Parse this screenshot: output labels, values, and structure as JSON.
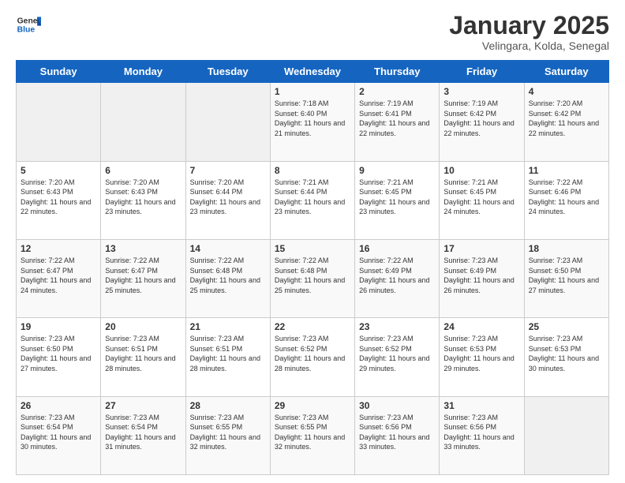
{
  "header": {
    "logo_general": "General",
    "logo_blue": "Blue",
    "month_title": "January 2025",
    "location": "Velingara, Kolda, Senegal"
  },
  "weekdays": [
    "Sunday",
    "Monday",
    "Tuesday",
    "Wednesday",
    "Thursday",
    "Friday",
    "Saturday"
  ],
  "weeks": [
    [
      {
        "day": "",
        "sunrise": "",
        "sunset": "",
        "daylight": ""
      },
      {
        "day": "",
        "sunrise": "",
        "sunset": "",
        "daylight": ""
      },
      {
        "day": "",
        "sunrise": "",
        "sunset": "",
        "daylight": ""
      },
      {
        "day": "1",
        "sunrise": "Sunrise: 7:18 AM",
        "sunset": "Sunset: 6:40 PM",
        "daylight": "Daylight: 11 hours and 21 minutes."
      },
      {
        "day": "2",
        "sunrise": "Sunrise: 7:19 AM",
        "sunset": "Sunset: 6:41 PM",
        "daylight": "Daylight: 11 hours and 22 minutes."
      },
      {
        "day": "3",
        "sunrise": "Sunrise: 7:19 AM",
        "sunset": "Sunset: 6:42 PM",
        "daylight": "Daylight: 11 hours and 22 minutes."
      },
      {
        "day": "4",
        "sunrise": "Sunrise: 7:20 AM",
        "sunset": "Sunset: 6:42 PM",
        "daylight": "Daylight: 11 hours and 22 minutes."
      }
    ],
    [
      {
        "day": "5",
        "sunrise": "Sunrise: 7:20 AM",
        "sunset": "Sunset: 6:43 PM",
        "daylight": "Daylight: 11 hours and 22 minutes."
      },
      {
        "day": "6",
        "sunrise": "Sunrise: 7:20 AM",
        "sunset": "Sunset: 6:43 PM",
        "daylight": "Daylight: 11 hours and 23 minutes."
      },
      {
        "day": "7",
        "sunrise": "Sunrise: 7:20 AM",
        "sunset": "Sunset: 6:44 PM",
        "daylight": "Daylight: 11 hours and 23 minutes."
      },
      {
        "day": "8",
        "sunrise": "Sunrise: 7:21 AM",
        "sunset": "Sunset: 6:44 PM",
        "daylight": "Daylight: 11 hours and 23 minutes."
      },
      {
        "day": "9",
        "sunrise": "Sunrise: 7:21 AM",
        "sunset": "Sunset: 6:45 PM",
        "daylight": "Daylight: 11 hours and 23 minutes."
      },
      {
        "day": "10",
        "sunrise": "Sunrise: 7:21 AM",
        "sunset": "Sunset: 6:45 PM",
        "daylight": "Daylight: 11 hours and 24 minutes."
      },
      {
        "day": "11",
        "sunrise": "Sunrise: 7:22 AM",
        "sunset": "Sunset: 6:46 PM",
        "daylight": "Daylight: 11 hours and 24 minutes."
      }
    ],
    [
      {
        "day": "12",
        "sunrise": "Sunrise: 7:22 AM",
        "sunset": "Sunset: 6:47 PM",
        "daylight": "Daylight: 11 hours and 24 minutes."
      },
      {
        "day": "13",
        "sunrise": "Sunrise: 7:22 AM",
        "sunset": "Sunset: 6:47 PM",
        "daylight": "Daylight: 11 hours and 25 minutes."
      },
      {
        "day": "14",
        "sunrise": "Sunrise: 7:22 AM",
        "sunset": "Sunset: 6:48 PM",
        "daylight": "Daylight: 11 hours and 25 minutes."
      },
      {
        "day": "15",
        "sunrise": "Sunrise: 7:22 AM",
        "sunset": "Sunset: 6:48 PM",
        "daylight": "Daylight: 11 hours and 25 minutes."
      },
      {
        "day": "16",
        "sunrise": "Sunrise: 7:22 AM",
        "sunset": "Sunset: 6:49 PM",
        "daylight": "Daylight: 11 hours and 26 minutes."
      },
      {
        "day": "17",
        "sunrise": "Sunrise: 7:23 AM",
        "sunset": "Sunset: 6:49 PM",
        "daylight": "Daylight: 11 hours and 26 minutes."
      },
      {
        "day": "18",
        "sunrise": "Sunrise: 7:23 AM",
        "sunset": "Sunset: 6:50 PM",
        "daylight": "Daylight: 11 hours and 27 minutes."
      }
    ],
    [
      {
        "day": "19",
        "sunrise": "Sunrise: 7:23 AM",
        "sunset": "Sunset: 6:50 PM",
        "daylight": "Daylight: 11 hours and 27 minutes."
      },
      {
        "day": "20",
        "sunrise": "Sunrise: 7:23 AM",
        "sunset": "Sunset: 6:51 PM",
        "daylight": "Daylight: 11 hours and 28 minutes."
      },
      {
        "day": "21",
        "sunrise": "Sunrise: 7:23 AM",
        "sunset": "Sunset: 6:51 PM",
        "daylight": "Daylight: 11 hours and 28 minutes."
      },
      {
        "day": "22",
        "sunrise": "Sunrise: 7:23 AM",
        "sunset": "Sunset: 6:52 PM",
        "daylight": "Daylight: 11 hours and 28 minutes."
      },
      {
        "day": "23",
        "sunrise": "Sunrise: 7:23 AM",
        "sunset": "Sunset: 6:52 PM",
        "daylight": "Daylight: 11 hours and 29 minutes."
      },
      {
        "day": "24",
        "sunrise": "Sunrise: 7:23 AM",
        "sunset": "Sunset: 6:53 PM",
        "daylight": "Daylight: 11 hours and 29 minutes."
      },
      {
        "day": "25",
        "sunrise": "Sunrise: 7:23 AM",
        "sunset": "Sunset: 6:53 PM",
        "daylight": "Daylight: 11 hours and 30 minutes."
      }
    ],
    [
      {
        "day": "26",
        "sunrise": "Sunrise: 7:23 AM",
        "sunset": "Sunset: 6:54 PM",
        "daylight": "Daylight: 11 hours and 30 minutes."
      },
      {
        "day": "27",
        "sunrise": "Sunrise: 7:23 AM",
        "sunset": "Sunset: 6:54 PM",
        "daylight": "Daylight: 11 hours and 31 minutes."
      },
      {
        "day": "28",
        "sunrise": "Sunrise: 7:23 AM",
        "sunset": "Sunset: 6:55 PM",
        "daylight": "Daylight: 11 hours and 32 minutes."
      },
      {
        "day": "29",
        "sunrise": "Sunrise: 7:23 AM",
        "sunset": "Sunset: 6:55 PM",
        "daylight": "Daylight: 11 hours and 32 minutes."
      },
      {
        "day": "30",
        "sunrise": "Sunrise: 7:23 AM",
        "sunset": "Sunset: 6:56 PM",
        "daylight": "Daylight: 11 hours and 33 minutes."
      },
      {
        "day": "31",
        "sunrise": "Sunrise: 7:23 AM",
        "sunset": "Sunset: 6:56 PM",
        "daylight": "Daylight: 11 hours and 33 minutes."
      },
      {
        "day": "",
        "sunrise": "",
        "sunset": "",
        "daylight": ""
      }
    ]
  ]
}
